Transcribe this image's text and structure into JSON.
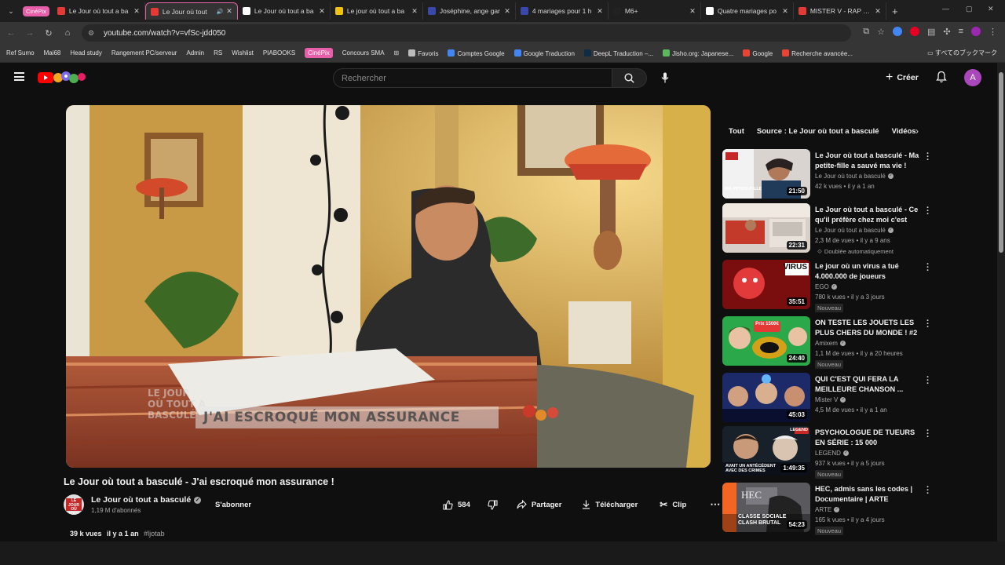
{
  "browser": {
    "tab_group_label": "CinéPix",
    "tabs": [
      {
        "title": "Le Jour où tout a ba",
        "color": "#e53935",
        "active": false
      },
      {
        "title": "Le Jour où tout",
        "color": "#e53935",
        "active": true
      },
      {
        "title": "Le Jour où tout a ba",
        "color": "#ffffff",
        "active": false
      },
      {
        "title": "Le jour où tout a ba",
        "color": "#f4c20d",
        "active": false
      },
      {
        "title": "Joséphine, ange gar",
        "color": "#3949ab",
        "active": false
      },
      {
        "title": "4 mariages pour 1 h",
        "color": "#3949ab",
        "active": false
      },
      {
        "title": "M6+",
        "color": "#222222",
        "active": false
      },
      {
        "title": "Quatre mariages po",
        "color": "#ffffff",
        "active": false
      },
      {
        "title": "MISTER V - RAP VS",
        "color": "#e53935",
        "active": false
      }
    ],
    "url": "youtube.com/watch?v=vfSc-jdd050",
    "bookmarks": [
      {
        "label": "Ref Sumo",
        "chip": false
      },
      {
        "label": "Mai68",
        "chip": false
      },
      {
        "label": "Head study",
        "chip": false
      },
      {
        "label": "Rangement PC/serveur",
        "chip": false
      },
      {
        "label": "Admin",
        "chip": false
      },
      {
        "label": "RS",
        "chip": false
      },
      {
        "label": "Wishlist",
        "chip": false
      },
      {
        "label": "PIABOOKS",
        "chip": false
      },
      {
        "label": "CinéPix",
        "chip": true
      },
      {
        "label": "Concours SMA",
        "chip": false
      },
      {
        "label": "Favoris",
        "chip": false
      },
      {
        "label": "Comptes Google",
        "chip": false
      },
      {
        "label": "Google Traduction",
        "chip": false
      },
      {
        "label": "DeepL Traduction –...",
        "chip": false
      },
      {
        "label": "Jisho.org: Japanese...",
        "chip": false
      },
      {
        "label": "Google",
        "chip": false
      },
      {
        "label": "Recherche avancée...",
        "chip": false
      }
    ],
    "bookmarks_folder": "すべてのブックマーク"
  },
  "header": {
    "search_placeholder": "Rechercher",
    "create_label": "Créer",
    "avatar_letter": "A"
  },
  "video": {
    "caption_text": "J'AI ESCROQUÉ MON ASSURANCE",
    "show_logo": "LE JOUR OÙ TOUT A BASCULÉ",
    "title": "Le Jour où tout a basculé - J'ai escroqué mon assurance !",
    "channel": "Le Jour où tout a basculé",
    "subscribers": "1,19 M d'abonnés",
    "subscribe_label": "S'abonner",
    "likes": "584",
    "share_label": "Partager",
    "download_label": "Télécharger",
    "clip_label": "Clip",
    "views": "39 k vues",
    "age": "il y a 1 an",
    "hashtag": "#ljotab"
  },
  "chips": [
    "Tout",
    "Source : Le Jour où tout a basculé",
    "Vidéos"
  ],
  "recommendations": [
    {
      "title": "Le Jour où tout a basculé - Ma petite-fille a sauvé ma vie !",
      "channel": "Le Jour où tout a basculé",
      "views": "42 k vues • il y a 1 an",
      "duration": "21:50",
      "badge": ""
    },
    {
      "title": "Le Jour où tout a basculé - Ce qu'il préfère chez moi c'est mo...",
      "channel": "Le Jour où tout a basculé",
      "views": "2,3 M de vues • il y a 9 ans",
      "duration": "22:31",
      "badge": "Doublée automatiquement"
    },
    {
      "title": "Le jour où un virus a tué 4.000.000 de joueurs",
      "channel": "EGO",
      "views": "780 k vues • il y a 3 jours",
      "duration": "35:51",
      "badge": "Nouveau"
    },
    {
      "title": "ON TESTE LES JOUETS LES PLUS CHERS DU MONDE ! #2 ...",
      "channel": "Amixem",
      "views": "1,1 M de vues • il y a 20 heures",
      "duration": "24:40",
      "badge": "Nouveau"
    },
    {
      "title": "QUI C'EST QUI FERA LA MEILLEURE CHANSON ...",
      "channel": "Mister V",
      "views": "4,5 M de vues • il y a 1 an",
      "duration": "45:03",
      "badge": ""
    },
    {
      "title": "PSYCHOLOGUE DE TUEURS EN SÉRIE : 15 000 ENTRETIENS ...",
      "channel": "LEGEND",
      "views": "937 k vues • il y a 5 jours",
      "duration": "1:49:35",
      "badge": "Nouveau"
    },
    {
      "title": "HEC, admis sans les codes | Documentaire | ARTE",
      "channel": "ARTE",
      "views": "165 k vues • il y a 4 jours",
      "duration": "54:23",
      "badge": "Nouveau"
    }
  ],
  "thumb_text": {
    "virus": "VIRUS",
    "prix": "Prix 1500€",
    "hec": "HEC",
    "hec_sub": "CLASSE SOCIALE CLASH BRUTAL",
    "legend": "LEGEND",
    "legend_sub": "AVAIT UN ANTÉCÉDENT AVEC DES CRIMES"
  },
  "colors": {
    "accent": "#e75fa8",
    "youtube_red": "#ff0000",
    "background": "#0f0f0f"
  }
}
